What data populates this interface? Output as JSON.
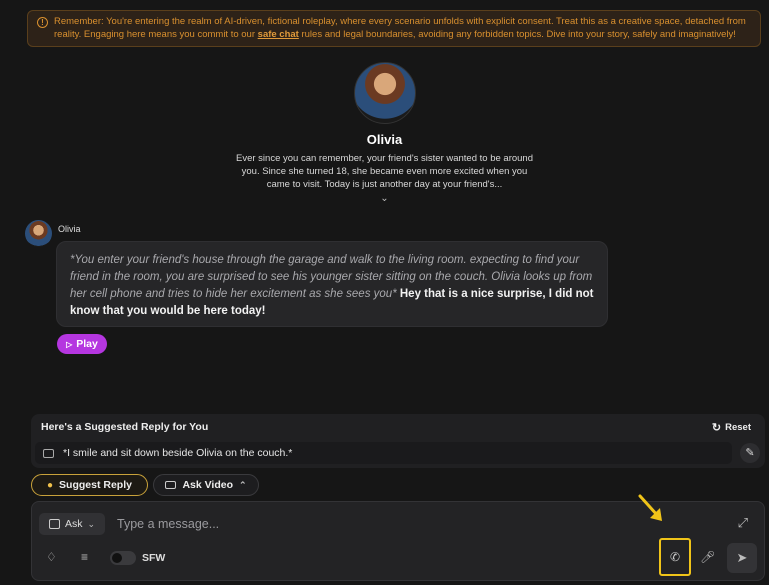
{
  "banner": {
    "text_before": "Remember: You're entering the realm of AI-driven, fictional roleplay, where every scenario unfolds with explicit consent. Treat this as a creative space, detached from reality. Engaging here means you commit to our ",
    "link": "safe chat",
    "text_after": " rules and legal boundaries, avoiding any forbidden topics. Dive into your story, safely and imaginatively!"
  },
  "profile": {
    "name": "Olivia",
    "description": "Ever since you can remember, your friend's sister wanted to be around you. Since she turned 18, she became even more excited when you came to visit. Today is just another day at your friend's..."
  },
  "message": {
    "sender": "Olivia",
    "action": "*You enter your friend's house through the garage and walk to the living room. expecting to find your friend in the room, you are surprised to see his younger sister sitting on the couch. Olivia looks up from her cell phone and tries to hide her excitement as she sees you*",
    "speech": " Hey that is a nice surprise, I did not know that you would be here today!",
    "play_label": "Play"
  },
  "suggestion": {
    "title": "Here's a Suggested Reply for You",
    "reset_label": "Reset",
    "text": "*I smile and sit down beside Olivia on the couch.*"
  },
  "actions": {
    "suggest_label": "Suggest Reply",
    "video_label": "Ask Video"
  },
  "composer": {
    "ask_label": "Ask",
    "placeholder": "Type a message...",
    "sfw_label": "SFW"
  },
  "colors": {
    "accent": "#b536e0",
    "warning": "#d9902f",
    "highlight": "#f0c419"
  }
}
